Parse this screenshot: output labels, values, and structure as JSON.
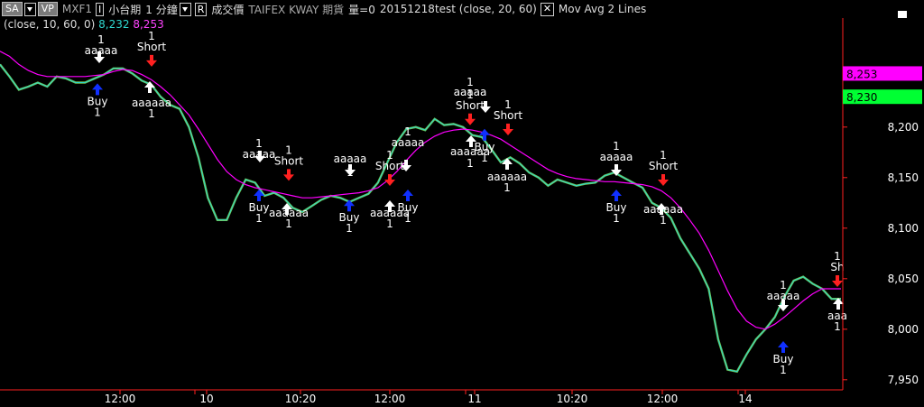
{
  "toolbar": {
    "sa_label": "SA",
    "vp_label": "VP",
    "symbol": "MXF1",
    "i_label": "I",
    "name_cn": "小台期",
    "interval": "1 分鐘",
    "r_label": "R",
    "price_type": "成交價",
    "exchange": "TAIFEX KWAY 期貨",
    "volume": "量=0",
    "study": "20151218test (close,  20,  60)",
    "overlay": "Mov Avg 2 Lines"
  },
  "params": {
    "ma_params": "(close,  10,  60,  0)",
    "ma1_value": "8,232",
    "ma2_value": "8,253"
  },
  "colors": {
    "ma_fast": "#2fd8d0",
    "ma_slow": "#ff00ff",
    "buy_arrow": "#1030ff",
    "short_arrow": "#ff2020",
    "axis": "#ff2020",
    "green_tag": "#00ff33"
  },
  "chart_data": {
    "type": "line",
    "y_ticks": [
      "8,200",
      "8,150",
      "8,100",
      "8,050",
      "8,000",
      "7,950"
    ],
    "ylim": [
      7940,
      8290
    ],
    "x_ticks": [
      "12:00",
      "10",
      "10:20",
      "12:00",
      "11",
      "10:20",
      "12:00",
      "14"
    ],
    "price_tags": [
      {
        "label": "8,253",
        "value": 8253,
        "color": "#ff00ff"
      },
      {
        "label": "8,230",
        "value": 8230,
        "color": "#00ff33"
      }
    ],
    "close_series": [
      8262,
      8250,
      8237,
      8240,
      8244,
      8240,
      8250,
      8248,
      8244,
      8244,
      8248,
      8252,
      8258,
      8258,
      8253,
      8246,
      8242,
      8230,
      8222,
      8218,
      8200,
      8170,
      8130,
      8108,
      8108,
      8130,
      8148,
      8145,
      8132,
      8135,
      8130,
      8120,
      8116,
      8122,
      8128,
      8132,
      8130,
      8126,
      8130,
      8134,
      8145,
      8165,
      8185,
      8198,
      8200,
      8197,
      8208,
      8202,
      8203,
      8200,
      8192,
      8190,
      8178,
      8165,
      8170,
      8164,
      8155,
      8150,
      8142,
      8148,
      8145,
      8142,
      8144,
      8145,
      8152,
      8155,
      8150,
      8145,
      8140,
      8125,
      8120,
      8110,
      8090,
      8075,
      8060,
      8040,
      7990,
      7960,
      7958,
      7975,
      7990,
      8000,
      8012,
      8032,
      8048,
      8052,
      8045,
      8040,
      8030,
      8030
    ],
    "ma_slow_series": [
      8275,
      8270,
      8262,
      8256,
      8252,
      8250,
      8250,
      8250,
      8250,
      8250,
      8251,
      8252,
      8255,
      8257,
      8256,
      8252,
      8247,
      8240,
      8232,
      8222,
      8212,
      8198,
      8183,
      8168,
      8156,
      8148,
      8143,
      8140,
      8138,
      8136,
      8134,
      8132,
      8130,
      8130,
      8131,
      8132,
      8133,
      8134,
      8135,
      8137,
      8140,
      8147,
      8156,
      8167,
      8177,
      8185,
      8191,
      8195,
      8197,
      8198,
      8197,
      8195,
      8192,
      8188,
      8182,
      8176,
      8170,
      8164,
      8158,
      8154,
      8151,
      8149,
      8148,
      8147,
      8146,
      8146,
      8145,
      8144,
      8143,
      8141,
      8137,
      8130,
      8120,
      8108,
      8095,
      8078,
      8058,
      8038,
      8020,
      8008,
      8002,
      8000,
      8005,
      8012,
      8020,
      8028,
      8035,
      8040,
      8040,
      8040
    ],
    "signals": [
      {
        "type": "Buy",
        "label": "Buy",
        "sub": "1",
        "value": 8245
      },
      {
        "type": "Short",
        "label": "Short",
        "sub": "1",
        "value": 8258
      },
      {
        "type": "Buy",
        "label": "Buy",
        "sub": "1",
        "value": 8140
      },
      {
        "type": "Short",
        "label": "Short",
        "sub": "1",
        "value": 8145
      },
      {
        "type": "Buy",
        "label": "Buy",
        "sub": "1",
        "value": 8130
      },
      {
        "type": "Short",
        "label": "Short",
        "sub": "1",
        "value": 8140
      },
      {
        "type": "Buy",
        "label": "Buy",
        "sub": "1",
        "value": 8140
      },
      {
        "type": "Short",
        "label": "Short",
        "sub": "1",
        "value": 8200
      },
      {
        "type": "Buy",
        "label": "Buy",
        "sub": "1",
        "value": 8200
      },
      {
        "type": "Short",
        "label": "Short",
        "sub": "1",
        "value": 8190
      },
      {
        "type": "Buy",
        "label": "Buy",
        "sub": "1",
        "value": 8140
      },
      {
        "type": "Short",
        "label": "Short",
        "sub": "1",
        "value": 8140
      },
      {
        "type": "Buy",
        "label": "Buy",
        "sub": "1",
        "value": 7990
      },
      {
        "type": "Short",
        "label": "Sh",
        "sub": "1",
        "value": 8040
      }
    ],
    "exit_labels": [
      "1",
      "aaaaa",
      "aaaaaa",
      "1",
      "aaa",
      "1"
    ],
    "grid": false
  }
}
